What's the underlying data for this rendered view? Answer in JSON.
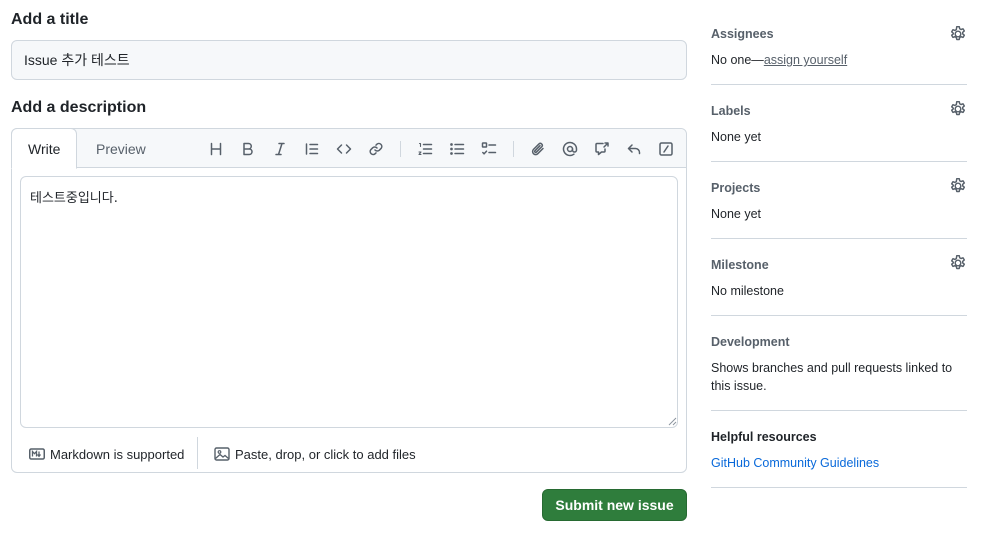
{
  "form": {
    "title_heading": "Add a title",
    "title_value": "Issue 추가 테스트",
    "description_heading": "Add a description",
    "tabs": [
      {
        "label": "Write",
        "active": true
      },
      {
        "label": "Preview",
        "active": false
      }
    ],
    "description_value": "테스트중입니다.",
    "toolbar": {
      "icons": [
        "heading-icon",
        "bold-icon",
        "italic-icon",
        "quote-icon",
        "code-icon",
        "link-icon",
        "numbered-list-icon",
        "unordered-list-icon",
        "task-list-icon",
        "attachment-icon",
        "mention-icon",
        "cross-reference-icon",
        "reply-icon",
        "slash-commands-icon"
      ]
    },
    "footer": {
      "markdown_label": "Markdown is supported",
      "attach_label": "Paste, drop, or click to add files"
    },
    "submit_label": "Submit new issue"
  },
  "sidebar": {
    "assignees": {
      "label": "Assignees",
      "value_prefix": "No one—",
      "value_link": "assign yourself"
    },
    "labels": {
      "label": "Labels",
      "value": "None yet"
    },
    "projects": {
      "label": "Projects",
      "value": "None yet"
    },
    "milestone": {
      "label": "Milestone",
      "value": "No milestone"
    },
    "development": {
      "label": "Development",
      "value": "Shows branches and pull requests linked to this issue."
    },
    "helpful": {
      "label": "Helpful resources",
      "link": "GitHub Community Guidelines"
    }
  },
  "colors": {
    "submit_bg": "#2f7d3c",
    "border": "#d0d7de",
    "muted_text": "#57606a",
    "link": "#0969da"
  }
}
